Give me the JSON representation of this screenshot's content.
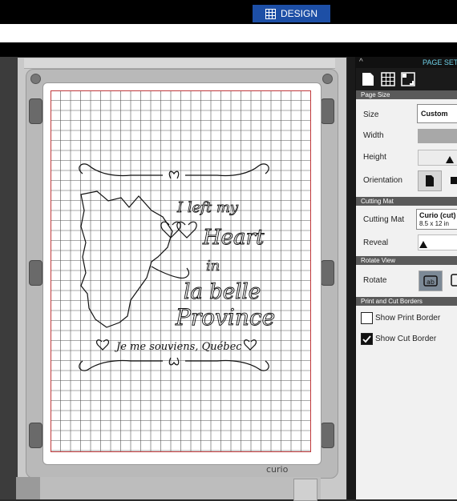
{
  "topbar": {
    "tab_label": "DESIGN"
  },
  "canvas": {
    "brand": "curio",
    "artwork": {
      "line1": "I left my",
      "line2": "Heart",
      "line3": "in",
      "line4": "la belle",
      "line5": "Province",
      "footer": "Je me souviens, Québec"
    }
  },
  "panel": {
    "title": "PAGE SETU",
    "sections": {
      "page_size": "Page Size",
      "cutting_mat": "Cutting Mat",
      "rotate_view": "Rotate View",
      "borders": "Print and Cut Borders"
    },
    "size_label": "Size",
    "size_value": "Custom",
    "width_label": "Width",
    "height_label": "Height",
    "orientation_label": "Orientation",
    "cutting_mat_label": "Cutting Mat",
    "mat_name": "Curio (cut)",
    "mat_size": "8.5 x 12 in",
    "reveal_label": "Reveal",
    "rotate_label": "Rotate",
    "show_print_border": "Show Print Border",
    "show_cut_border": "Show Cut Border",
    "print_border_checked": false,
    "cut_border_checked": true,
    "height_slider": 0.68,
    "reveal_slider": 0.02
  },
  "colors": {
    "design_tab": "#1d4fa6",
    "panel_title": "#6fd1e8",
    "grid_line": "#555555",
    "cut_border": "#c0393b"
  }
}
